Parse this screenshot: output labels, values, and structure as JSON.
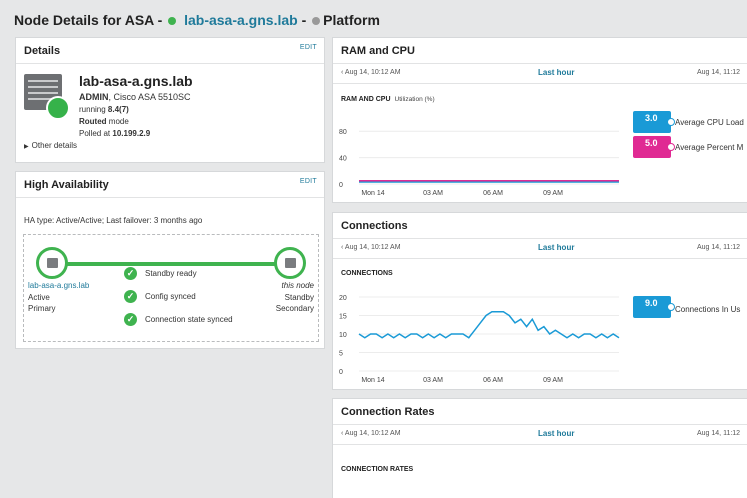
{
  "header": {
    "prefix": "Node Details for ASA -",
    "node": "lab-asa-a.gns.lab",
    "sep": "-",
    "section": "Platform"
  },
  "details": {
    "title": "Details",
    "edit": "EDIT",
    "name": "lab-asa-a.gns.lab",
    "admin": "ADMIN",
    "model": "Cisco ASA 5510SC",
    "running_label": "running",
    "running_value": "8.4(7)",
    "mode_value": "Routed",
    "mode_label": "mode",
    "polled_label": "Polled at",
    "polled_value": "10.199.2.9",
    "other": "Other details"
  },
  "ha": {
    "title": "High Availability",
    "edit": "EDIT",
    "type_text": "HA type: Active/Active; Last failover: 3 months ago",
    "left_node": "lab-asa-a.gns.lab",
    "left_role": "Active",
    "left_pos": "Primary",
    "right_node": "this node",
    "right_role": "Standby",
    "right_pos": "Secondary",
    "checks": [
      "Standby ready",
      "Config synced",
      "Connection state synced"
    ]
  },
  "ram_cpu": {
    "title": "RAM and CPU",
    "nav_left": "Aug 14, 10:12 AM",
    "nav_center": "Last hour",
    "nav_right": "Aug 14, 11:12",
    "chart_label": "RAM AND CPU",
    "chart_sub": "Utilization (%)",
    "legend": [
      {
        "value": "3.0",
        "color": "#1a9ad6",
        "label": "Average CPU Load"
      },
      {
        "value": "5.0",
        "color": "#e02a93",
        "label": "Average Percent M"
      }
    ]
  },
  "connections": {
    "title": "Connections",
    "nav_left": "Aug 14, 10:12 AM",
    "nav_center": "Last hour",
    "nav_right": "Aug 14, 11:12",
    "chart_label": "CONNECTIONS",
    "legend": [
      {
        "value": "9.0",
        "color": "#1a9ad6",
        "label": "Connections In Us"
      }
    ]
  },
  "rates": {
    "title": "Connection Rates",
    "nav_left": "Aug 14, 10:12 AM",
    "nav_center": "Last hour",
    "nav_right": "Aug 14, 11:12",
    "chart_label": "CONNECTION RATES"
  },
  "chart_data": [
    {
      "type": "line",
      "title": "RAM AND CPU",
      "ylabel": "Utilization (%)",
      "categories": [
        "Mon 14",
        "03 AM",
        "06 AM",
        "09 AM"
      ],
      "ylim": [
        0,
        100
      ],
      "yticks": [
        0,
        40,
        80
      ],
      "series": [
        {
          "name": "Average CPU Load",
          "color": "#1a9ad6",
          "values": [
            3,
            3,
            3,
            3,
            3,
            3,
            3,
            3,
            3,
            3,
            3,
            3
          ]
        },
        {
          "name": "Average Percent M",
          "color": "#e02a93",
          "values": [
            5,
            5,
            5,
            5,
            5,
            5,
            5,
            5,
            5,
            5,
            5,
            5
          ]
        }
      ]
    },
    {
      "type": "line",
      "title": "CONNECTIONS",
      "categories": [
        "Mon 14",
        "03 AM",
        "06 AM",
        "09 AM"
      ],
      "ylim": [
        0,
        20
      ],
      "yticks": [
        0,
        5,
        10,
        15,
        20
      ],
      "series": [
        {
          "name": "Connections In Us",
          "color": "#1a9ad6",
          "values": [
            10,
            9,
            10,
            10,
            9,
            10,
            9,
            10,
            9,
            10,
            10,
            9,
            10,
            9,
            10,
            9,
            10,
            10,
            10,
            9,
            11,
            13,
            15,
            16,
            16,
            16,
            15,
            13,
            14,
            12,
            14,
            11,
            12,
            10,
            11,
            10,
            9,
            10,
            9,
            10,
            10,
            9,
            10,
            9,
            10,
            9
          ]
        }
      ]
    }
  ]
}
